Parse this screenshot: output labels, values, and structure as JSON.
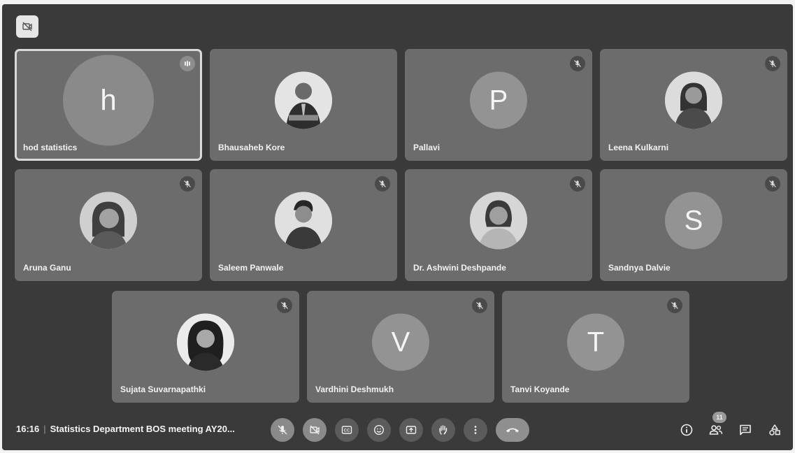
{
  "meeting": {
    "time": "16:16",
    "separator": "|",
    "title": "Statistics Department BOS meeting AY20...",
    "participant_count": "11"
  },
  "participants": [
    {
      "name": "hod statistics",
      "initial": "h",
      "avatar": "initial",
      "mic": "speaking"
    },
    {
      "name": "Bhausaheb Kore",
      "initial": "",
      "avatar": "photo",
      "mic": "on"
    },
    {
      "name": "Pallavi",
      "initial": "P",
      "avatar": "initial",
      "mic": "muted"
    },
    {
      "name": "Leena Kulkarni",
      "initial": "",
      "avatar": "photo",
      "mic": "muted"
    },
    {
      "name": "Aruna Ganu",
      "initial": "",
      "avatar": "photo",
      "mic": "muted"
    },
    {
      "name": "Saleem Panwale",
      "initial": "",
      "avatar": "photo",
      "mic": "muted"
    },
    {
      "name": "Dr. Ashwini Deshpande",
      "initial": "",
      "avatar": "photo",
      "mic": "muted"
    },
    {
      "name": "Sandnya Dalvie",
      "initial": "S",
      "avatar": "initial",
      "mic": "muted"
    },
    {
      "name": "Sujata Suvarnapathki",
      "initial": "",
      "avatar": "photo",
      "mic": "muted"
    },
    {
      "name": "Vardhini Deshmukh",
      "initial": "V",
      "avatar": "initial",
      "mic": "muted"
    },
    {
      "name": "Tanvi Koyande",
      "initial": "T",
      "avatar": "initial",
      "mic": "muted"
    }
  ],
  "controls": [
    {
      "icon": "mic-off-icon",
      "state": "off"
    },
    {
      "icon": "camera-off-icon",
      "state": "off"
    },
    {
      "icon": "captions-icon",
      "state": "normal"
    },
    {
      "icon": "emoji-icon",
      "state": "normal"
    },
    {
      "icon": "present-screen-icon",
      "state": "normal"
    },
    {
      "icon": "raise-hand-icon",
      "state": "normal"
    },
    {
      "icon": "more-options-icon",
      "state": "normal"
    },
    {
      "icon": "end-call-icon",
      "state": "end"
    }
  ],
  "side_controls": [
    "info-icon",
    "people-icon",
    "chat-icon",
    "activities-icon"
  ]
}
